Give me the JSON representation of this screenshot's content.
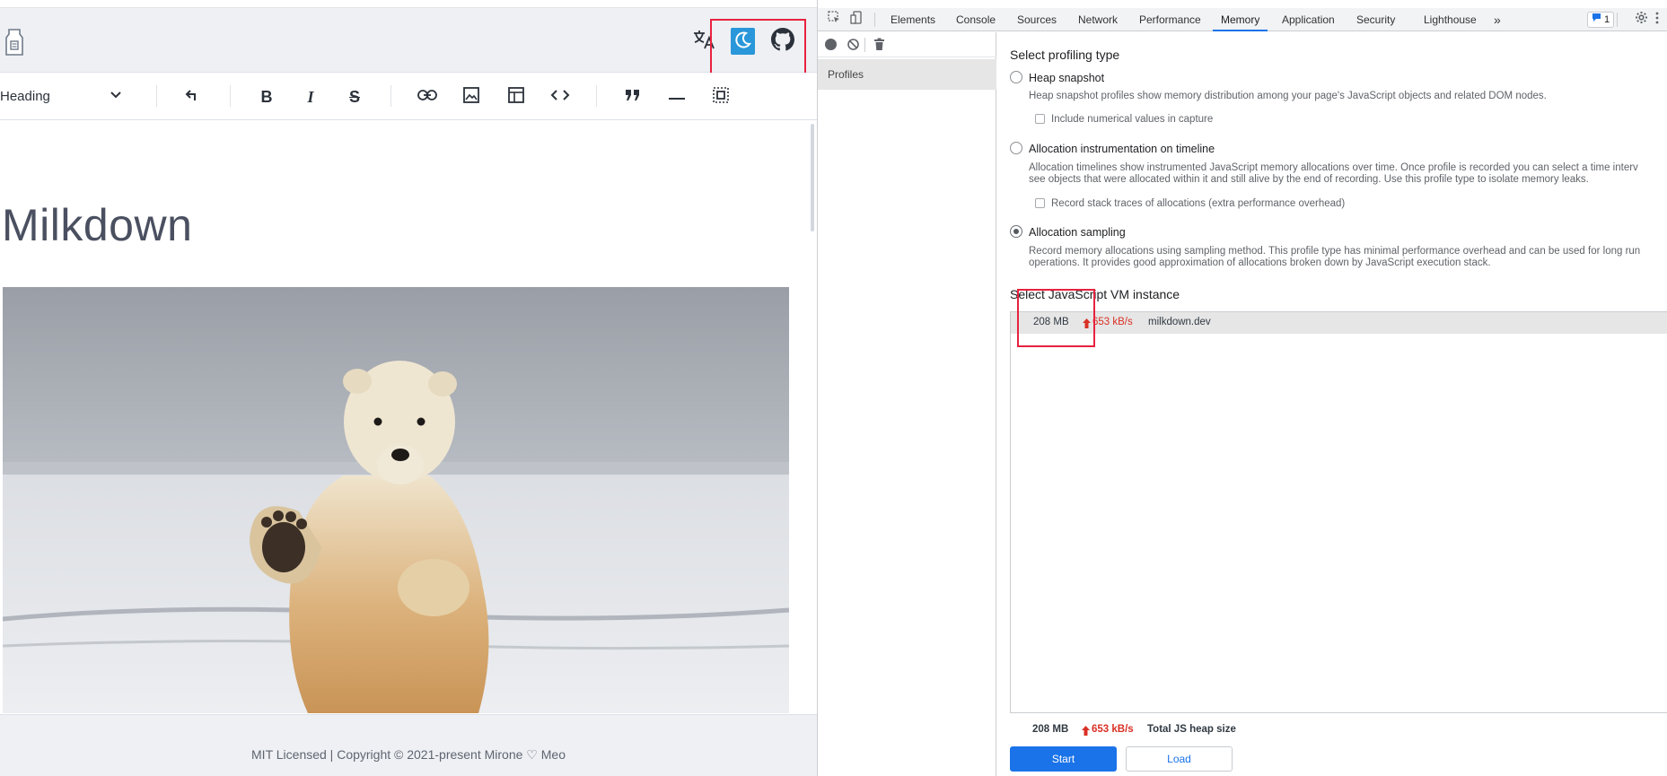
{
  "page": {
    "toolbar": {
      "heading_select": "Heading"
    },
    "document": {
      "title": "Milkdown",
      "image_subject": "polar bear waving on snow"
    },
    "footer": {
      "text": "MIT Licensed | Copyright © 2021-present Mirone ♡ Meo"
    },
    "icons": {
      "logo": "milkdown-logo",
      "translate": "translate-icon",
      "theme": "moon-icon",
      "github": "github-icon"
    }
  },
  "devtools": {
    "tabs": [
      "Elements",
      "Console",
      "Sources",
      "Network",
      "Performance",
      "Memory",
      "Application",
      "Security",
      "Lighthouse"
    ],
    "active_tab": "Memory",
    "more_tabs": "»",
    "issues_count": "1",
    "sidebar": {
      "profiles_header": "Profiles"
    },
    "profiling": {
      "title": "Select profiling type",
      "options": [
        {
          "label": "Heap snapshot",
          "desc": [
            "Heap snapshot profiles show memory distribution among your page's JavaScript objects and related DOM nodes."
          ],
          "checkbox": "Include numerical values in capture",
          "selected": false
        },
        {
          "label": "Allocation instrumentation on timeline",
          "desc": [
            "Allocation timelines show instrumented JavaScript memory allocations over time. Once profile is recorded you can select a time interv",
            "see objects that were allocated within it and still alive by the end of recording. Use this profile type to isolate memory leaks."
          ],
          "checkbox": "Record stack traces of allocations (extra performance overhead)",
          "selected": false
        },
        {
          "label": "Allocation sampling",
          "desc": [
            "Record memory allocations using sampling method. This profile type has minimal performance overhead and can be used for long run",
            "operations. It provides good approximation of allocations broken down by JavaScript execution stack."
          ],
          "selected": true
        }
      ]
    },
    "vm": {
      "title": "Select JavaScript VM instance",
      "instance": {
        "size": "208 MB",
        "rate": "653 kB/s",
        "name": "milkdown.dev"
      }
    },
    "summary": {
      "size": "208 MB",
      "rate": "653 kB/s",
      "label": "Total JS heap size"
    },
    "buttons": {
      "start": "Start",
      "load": "Load"
    },
    "colors": {
      "accent": "#1a73e8",
      "rate_red": "#d93025",
      "highlight_box": "#e8223f",
      "theme_button": "#2997d9"
    }
  }
}
